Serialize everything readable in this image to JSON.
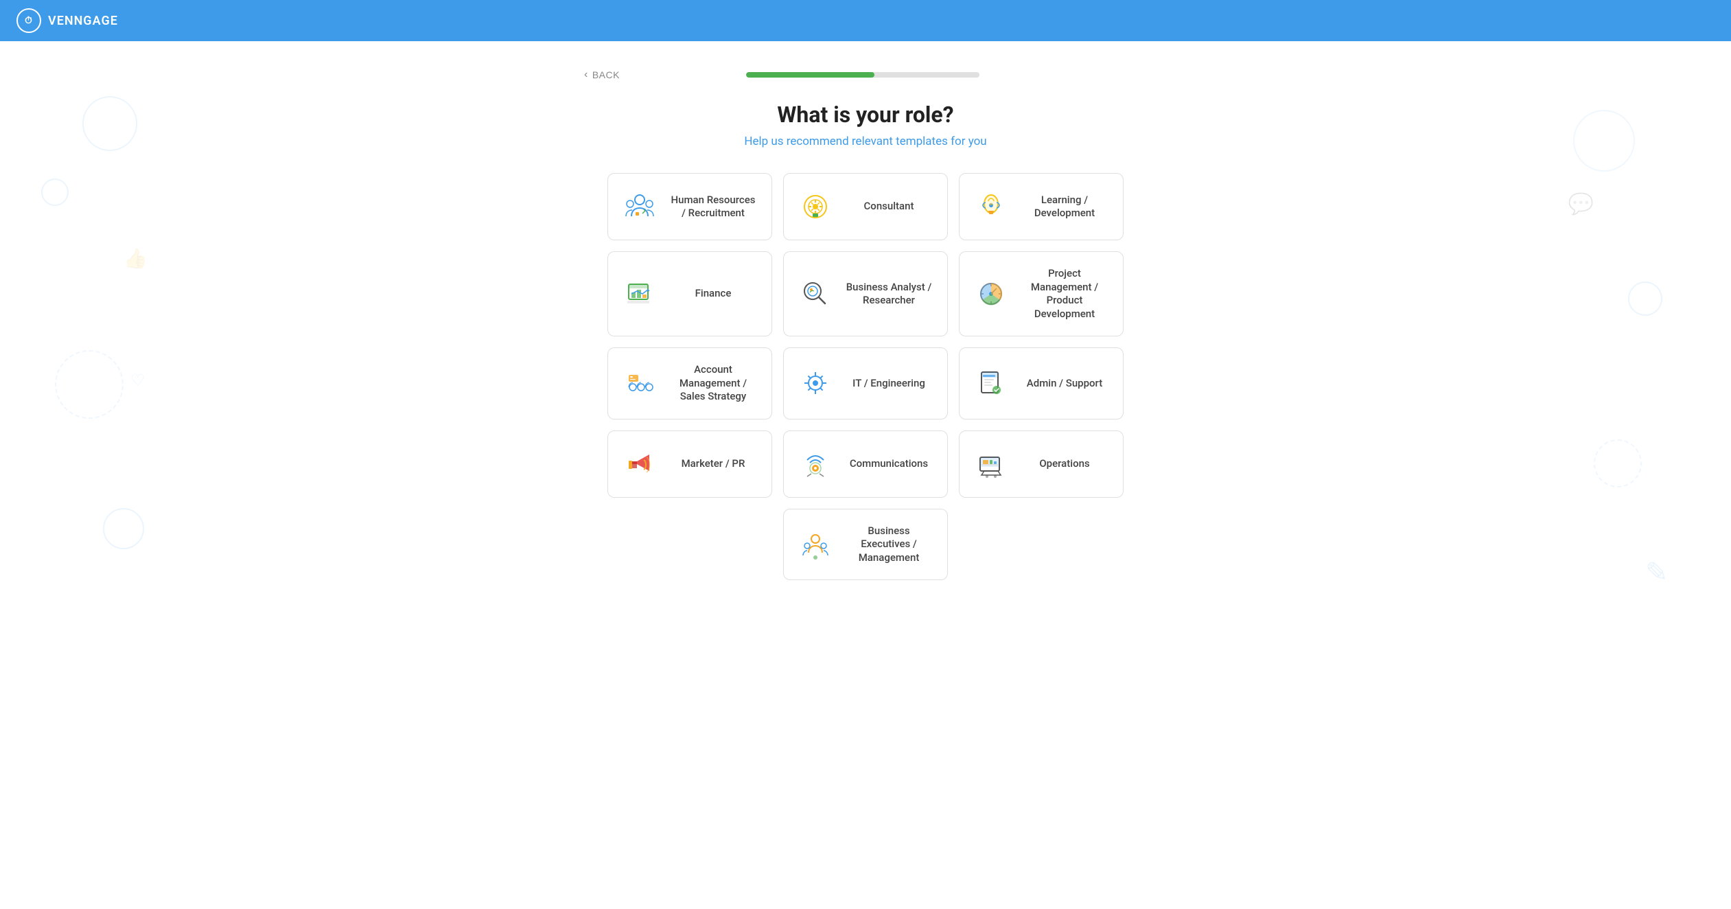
{
  "header": {
    "logo_text": "VENNGAGE",
    "logo_icon": "⏱"
  },
  "nav": {
    "back_label": "BACK",
    "progress_percent": 55,
    "progress_color": "#4caf50"
  },
  "page": {
    "heading": "What is your role?",
    "subheading": "Help us recommend relevant templates for you"
  },
  "roles": [
    {
      "id": "human-resources",
      "label": "Human Resources / Recruitment",
      "icon": "hr"
    },
    {
      "id": "consultant",
      "label": "Consultant",
      "icon": "consultant"
    },
    {
      "id": "learning-development",
      "label": "Learning / Development",
      "icon": "learning"
    },
    {
      "id": "finance",
      "label": "Finance",
      "icon": "finance"
    },
    {
      "id": "business-analyst",
      "label": "Business Analyst / Researcher",
      "icon": "analyst"
    },
    {
      "id": "project-management",
      "label": "Project Management / Product Development",
      "icon": "project"
    },
    {
      "id": "account-management",
      "label": "Account Management / Sales Strategy",
      "icon": "sales"
    },
    {
      "id": "it-engineering",
      "label": "IT / Engineering",
      "icon": "engineering"
    },
    {
      "id": "admin-support",
      "label": "Admin / Support",
      "icon": "admin"
    },
    {
      "id": "marketer-pr",
      "label": "Marketer / PR",
      "icon": "marketer"
    },
    {
      "id": "communications",
      "label": "Communications",
      "icon": "communications"
    },
    {
      "id": "operations",
      "label": "Operations",
      "icon": "operations"
    },
    {
      "id": "business-executives",
      "label": "Business Executives / Management",
      "icon": "executives"
    }
  ]
}
